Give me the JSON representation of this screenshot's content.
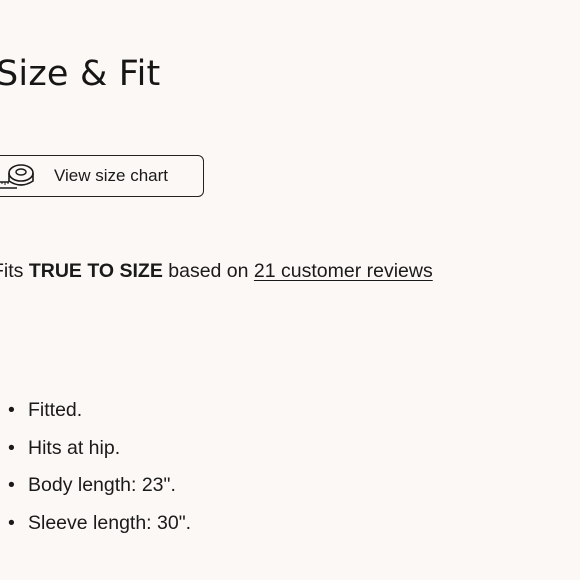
{
  "heading": "Size & Fit",
  "size_chart_button": {
    "label": "View size chart",
    "icon": "measuring-tape-icon"
  },
  "fit": {
    "prefix": "Fits ",
    "rating": "TRUE TO SIZE",
    "middle": " based on ",
    "reviews_link": "21 customer reviews"
  },
  "details": [
    "Fitted.",
    "Hits at hip.",
    "Body length: 23\".",
    "Sleeve length: 30\"."
  ],
  "colors": {
    "background": "#fcf8f6",
    "text": "#1a1a1a"
  }
}
